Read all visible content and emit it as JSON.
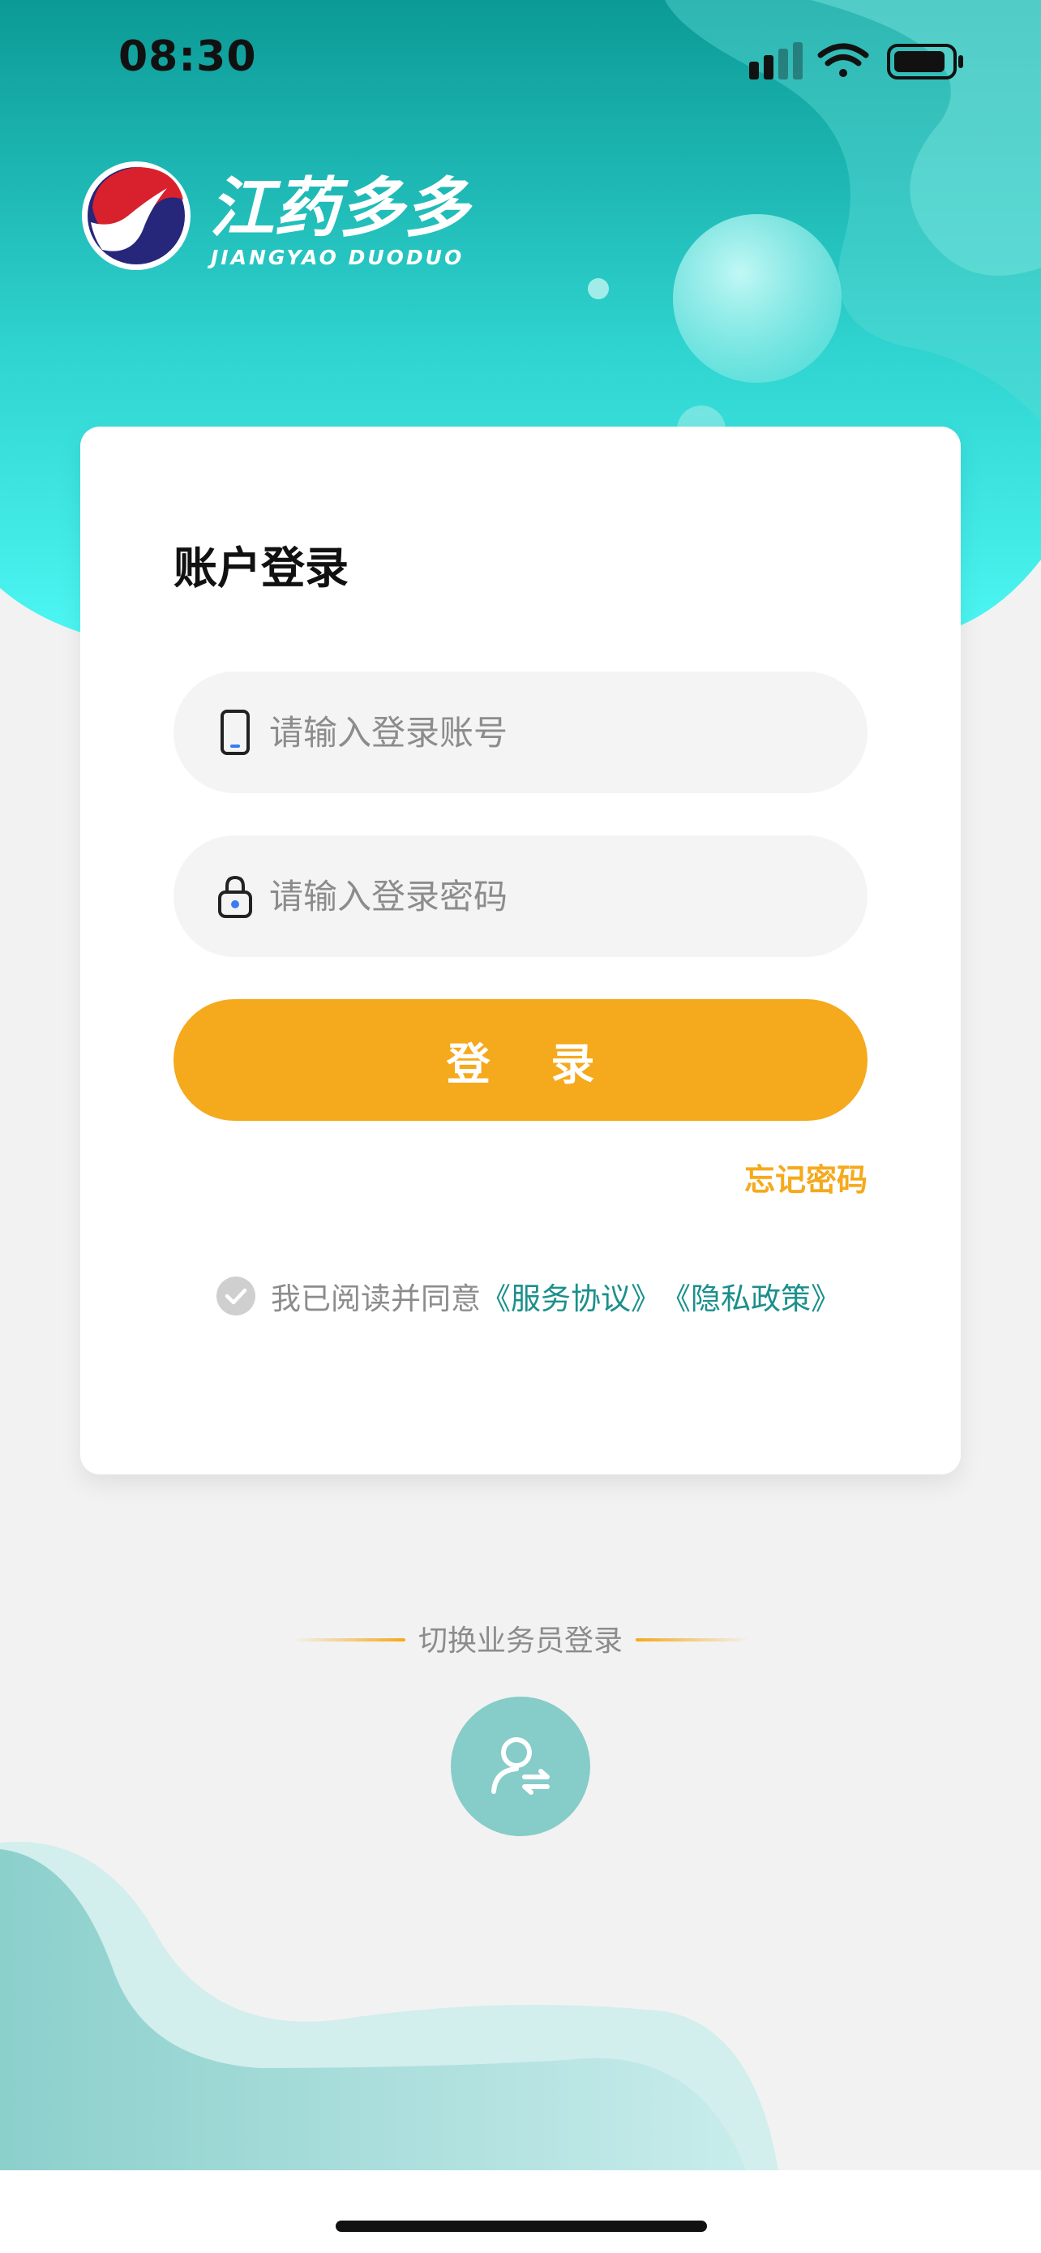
{
  "status_bar": {
    "time": "08:30"
  },
  "logo": {
    "name_cn": "江药多多",
    "name_en": "JIANGYAO DUODUO"
  },
  "login_card": {
    "title": "账户登录",
    "account_placeholder": "请输入登录账号",
    "password_placeholder": "请输入登录密码",
    "login_button": "登 录",
    "forgot_password": "忘记密码",
    "agreement_prefix": "我已阅读并同意",
    "service_agreement": "《服务协议》",
    "privacy_policy": "《隐私政策》"
  },
  "switch": {
    "label": "切换业务员登录"
  },
  "colors": {
    "accent": "#f5a91c",
    "header_teal_dark": "#14a09c",
    "header_teal_light": "#49f2ee",
    "link": "#1b8f8c",
    "switch_button": "#86ccc8"
  },
  "icons": {
    "account": "phone-icon",
    "password": "lock-icon",
    "agreement": "check-circle-icon",
    "switch": "user-switch-icon"
  }
}
